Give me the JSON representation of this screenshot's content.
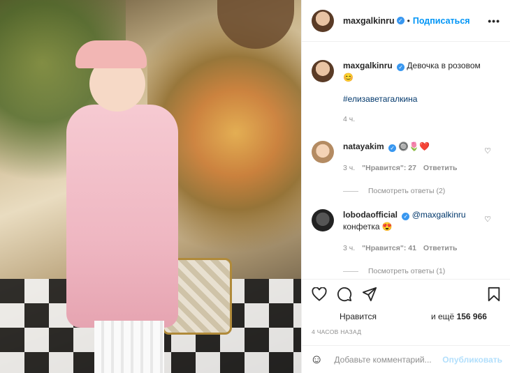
{
  "post": {
    "image_alt": "Девочка в розовом пальто и розовом козырьке среди цветов",
    "author": "maxgalkinru",
    "separator": "•",
    "follow_label": "Подписаться",
    "more_label": "•••"
  },
  "caption": {
    "author": "maxgalkinru",
    "text": "Девочка в розовом",
    "emoji": "😊",
    "hashtag": "#елизаветагалкина",
    "time": "4 ч."
  },
  "comments": [
    {
      "author": "natayakim",
      "text": "",
      "emoji": "🔘🌷❤️",
      "time": "3 ч.",
      "likes": "\"Нравится\": 27",
      "reply_label": "Ответить",
      "view_replies": "Посмотреть ответы (2)"
    },
    {
      "author": "lobodaofficial",
      "mention": "@maxgalkinru",
      "text": "конфетка",
      "emoji": "😍",
      "time": "3 ч.",
      "likes": "\"Нравится\": 41",
      "reply_label": "Ответить",
      "view_replies": "Посмотреть ответы (1)"
    }
  ],
  "actions": {
    "liked_by": "Нравится",
    "and_more_prefix": "и ещё",
    "count": "156 966",
    "timestamp": "4 ЧАСОВ НАЗАД"
  },
  "add_comment": {
    "placeholder": "Добавьте комментарий...",
    "post_label": "Опубликовать"
  },
  "colors": {
    "link": "#0095f6",
    "verified": "#3897f0",
    "muted": "#8e8e8e",
    "post_disabled": "#b2dffc"
  }
}
